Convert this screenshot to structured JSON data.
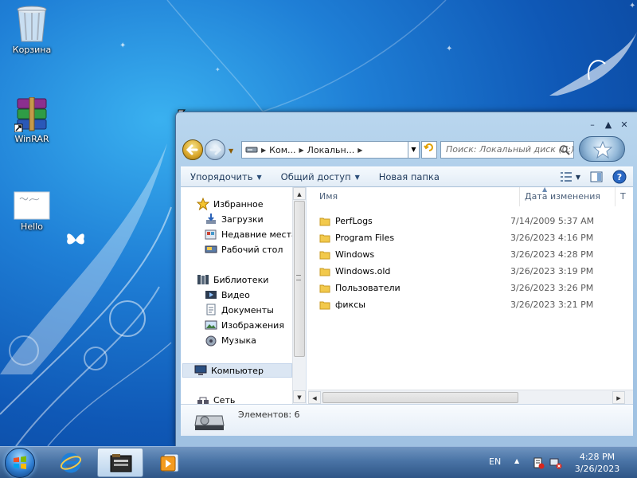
{
  "desktop": {
    "icons": [
      {
        "label": "Корзина",
        "icon": "recycle-bin-icon"
      },
      {
        "label": "WinRAR",
        "icon": "winrar-icon"
      },
      {
        "label": "Hello",
        "icon": "image-file-icon"
      }
    ]
  },
  "explorer": {
    "address": {
      "segments": [
        "Ком...",
        "Локальн..."
      ]
    },
    "search": {
      "placeholder": "Поиск: Локальный диск (C:)"
    },
    "toolbar": {
      "organize": "Упорядочить",
      "share": "Общий доступ",
      "new_folder": "Новая папка"
    },
    "nav": {
      "favorites": "Избранное",
      "downloads": "Загрузки",
      "recent": "Недавние места",
      "desktop": "Рабочий стол",
      "libraries": "Библиотеки",
      "video": "Видео",
      "documents": "Документы",
      "pictures": "Изображения",
      "music": "Музыка",
      "computer": "Компьютер",
      "network": "Сеть"
    },
    "columns": {
      "name": "Имя",
      "date": "Дата изменения",
      "type": "Т"
    },
    "files": [
      {
        "name": "PerfLogs",
        "date": "7/14/2009 5:37 AM"
      },
      {
        "name": "Program Files",
        "date": "3/26/2023 4:16 PM"
      },
      {
        "name": "Windows",
        "date": "3/26/2023 4:28 PM"
      },
      {
        "name": "Windows.old",
        "date": "3/26/2023 3:19 PM"
      },
      {
        "name": "Пользователи",
        "date": "3/26/2023 3:26 PM"
      },
      {
        "name": "фиксы",
        "date": "3/26/2023 3:21 PM"
      }
    ],
    "details": {
      "count": "Элементов: 6"
    }
  },
  "taskbar": {
    "language": "EN",
    "time": "4:28 PM",
    "date": "3/26/2023",
    "pinned": [
      "internet-explorer-icon",
      "explorer-icon",
      "media-player-icon"
    ]
  },
  "colors": {
    "wallpaper_mid": "#1f7fd6",
    "toolbar_text": "#1e395b",
    "folder": "#f2c94c"
  }
}
